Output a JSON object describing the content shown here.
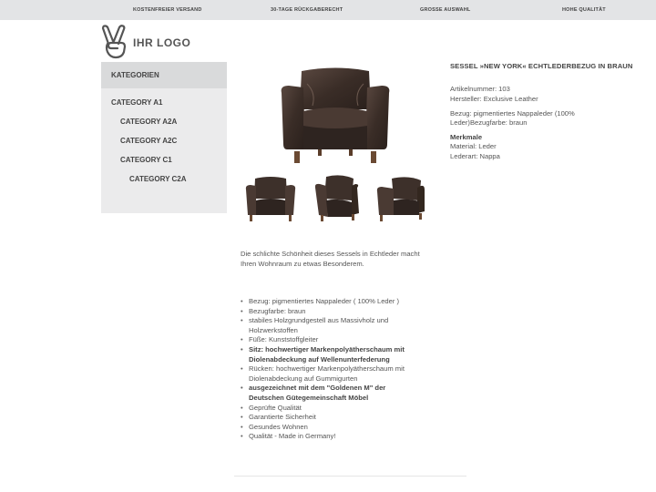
{
  "topbar": {
    "items": [
      "KOSTENFREIER VERSAND",
      "30-TAGE RÜCKGABERECHT",
      "GROSSE AUSWAHL",
      "HOHE QUALITÄT"
    ]
  },
  "logo": {
    "text": "IHR LOGO",
    "icon": "peace-hand-icon"
  },
  "sidebar": {
    "heading": "KATEGORIEN",
    "items": [
      {
        "label": "CATEGORY A1"
      },
      {
        "label": "CATEGORY A2A"
      },
      {
        "label": "CATEGORY A2C"
      },
      {
        "label": "CATEGORY C1"
      },
      {
        "label": "CATEGORY C2A"
      }
    ]
  },
  "product": {
    "title": "SESSEL »NEW YORK« ECHTLEDERBEZUG IN BRAUN",
    "article_number": "Artikelnummer: 103",
    "manufacturer": "Hersteller: Exclusive Leather",
    "cover_line1": "Bezug: pigmentiertes Nappaleder (100%",
    "cover_line2": "Leder)Bezugfarbe: braun",
    "features_heading": "Merkmale",
    "material": "Material:  Leder",
    "leather_type": "Lederart:  Nappa",
    "description": "Die schlichte Schönheit dieses Sessels in Echtleder macht Ihren Wohnraum zu etwas Besonderem.",
    "features": [
      {
        "text": "Bezug: pigmentiertes Nappaleder ( 100% Leder )",
        "bold": false
      },
      {
        "text": "Bezugfarbe: braun",
        "bold": false
      },
      {
        "text": "stabiles Holzgrundgestell aus Massivholz und Holzwerkstoffen",
        "bold": false
      },
      {
        "text": "Füße: Kunststoffgleiter",
        "bold": false
      },
      {
        "text": "Sitz: hochwertiger Markenpolyätherschaum mit Diolenabdeckung auf Wellenunterfederung",
        "bold": true
      },
      {
        "text": "Rücken: hochwertiger Markenpolyätherschaum mit Diolenabdeckung auf Gummigurten",
        "bold": false
      },
      {
        "text": "ausgezeichnet mit dem \"Goldenen M\" der Deutschen Gütegemeinschaft Möbel",
        "bold": true
      },
      {
        "text": "Geprüfte Qualität",
        "bold": false
      },
      {
        "text": "Garantierte Sicherheit",
        "bold": false
      },
      {
        "text": "Gesundes Wohnen",
        "bold": false
      },
      {
        "text": "Qualität - Made in Germany!",
        "bold": false
      }
    ]
  },
  "colors": {
    "topbar_bg": "#e3e4e6",
    "sidebar_bg": "#ebebec",
    "sidebar_head_bg": "#d9dadb",
    "leather": "#3d302a",
    "legs": "#6b4a33"
  }
}
